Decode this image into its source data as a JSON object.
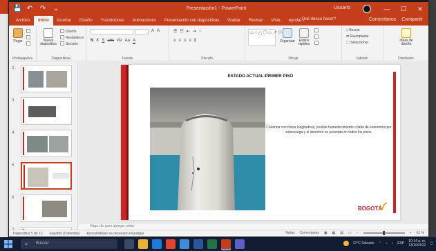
{
  "window": {
    "title": "Presentación1 - PowerPoint",
    "user": "Usuario",
    "controls": {
      "minimize": "—",
      "maximize": "☐",
      "close": "✕"
    }
  },
  "quick_access": {
    "save": "💾",
    "undo": "↶",
    "redo": "↷",
    "more": "⌄"
  },
  "ribbon": {
    "tabs": [
      "Archivo",
      "Inicio",
      "Insertar",
      "Diseño",
      "Transiciones",
      "Animaciones",
      "Presentación con diapositivas",
      "Grabar",
      "Revisar",
      "Vista",
      "Ayuda"
    ],
    "active_tab": "Inicio",
    "search": "¿Qué desea hacer?",
    "share": "Compartir",
    "comments": "Comentarios",
    "groups": {
      "clipboard": {
        "label": "Portapapeles",
        "paste": "Pegar"
      },
      "slides": {
        "label": "Diapositivas",
        "new_slide": "Nueva diapositiva",
        "layout": "Diseño",
        "reset": "Restablecer",
        "section": "Sección"
      },
      "font": {
        "label": "Fuente",
        "bold": "N",
        "italic": "K",
        "underline": "S",
        "strike": "abc",
        "spacing": "AV",
        "case": "Aa"
      },
      "paragraph": {
        "label": "Párrafo"
      },
      "drawing": {
        "label": "Dibujo",
        "arrange": "Organizar",
        "quick_styles": "Estilos rápidos",
        "fill": "Relleno de forma",
        "outline": "Contorno de forma",
        "effects": "Efectos de forma"
      },
      "editing": {
        "label": "Edición",
        "find": "Buscar",
        "replace": "Reemplazar",
        "select": "Seleccionar"
      },
      "designer": {
        "label": "Diseñador",
        "ideas": "Ideas de diseño"
      }
    }
  },
  "thumbnails": {
    "numbers": [
      "2",
      "3",
      "4",
      "5",
      "6",
      "7"
    ],
    "selected_index": 3
  },
  "slide": {
    "title": "ESTADO ACTUAL-PRIMER PISO",
    "body": "Columna con fisura longitudinal, posible humedecimiento o falta de elementos por sobrecarga y el deterioro se presenta en todos los pisos.",
    "logo_text": "BOGOTÁ"
  },
  "notes": {
    "placeholder": "Haga clic para agregar notas"
  },
  "status": {
    "slide_counter": "Diapositiva 5 de 12",
    "language": "Español (Colombia)",
    "accessibility": "Accesibilidad: es necesario investigar",
    "notes_btn": "Notas",
    "comments_btn": "Comentarios",
    "zoom": "61 %"
  },
  "taskbar": {
    "search_placeholder": "Buscar",
    "weather": "17°C Soleado",
    "language": "ESP",
    "time": "10:14 a. m.",
    "date": "13/10/2022"
  },
  "colors": {
    "accent": "#c43e1c",
    "slide_red": "#c62828",
    "taskbar": "#101d33"
  }
}
